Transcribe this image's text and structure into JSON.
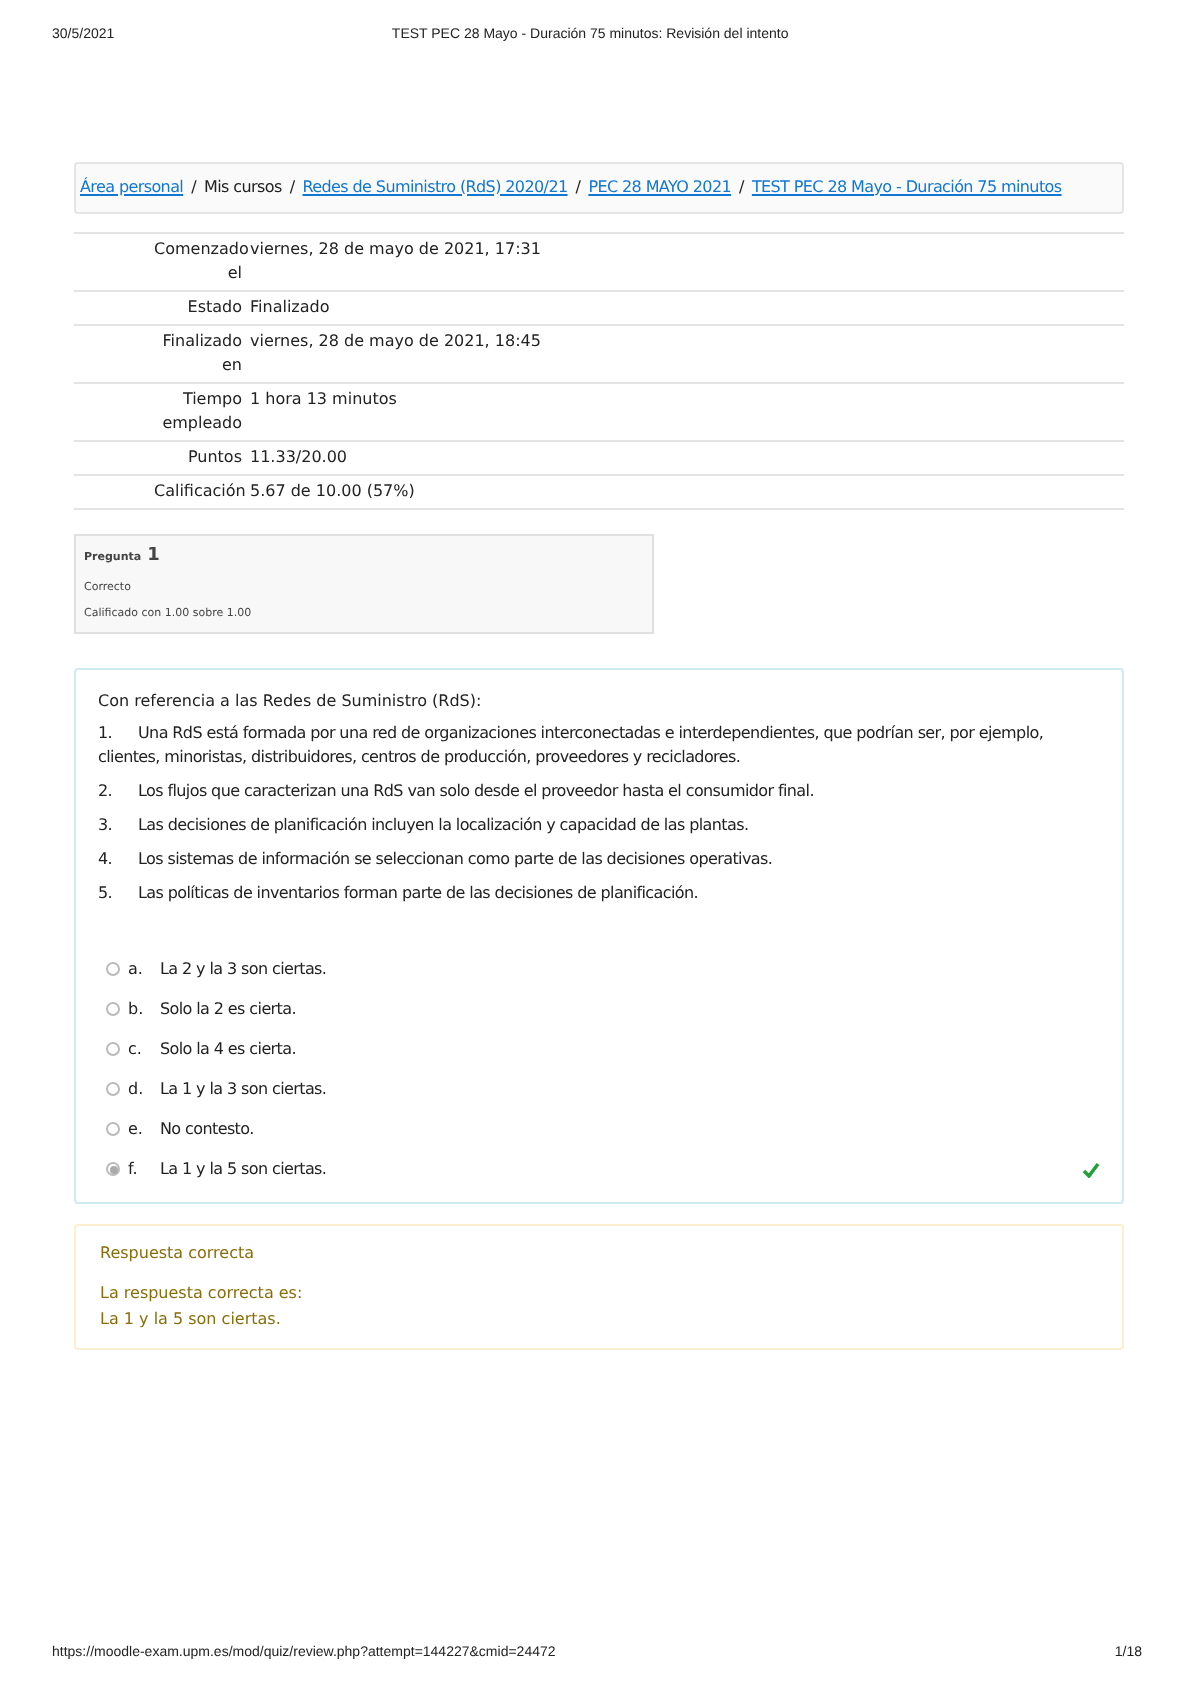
{
  "print_header": {
    "date": "30/5/2021",
    "title": "TEST PEC 28 Mayo - Duración 75 minutos: Revisión del intento"
  },
  "breadcrumb": [
    {
      "kind": "link",
      "label": "Área personal"
    },
    {
      "kind": "separator",
      "label": "/"
    },
    {
      "kind": "text",
      "label": "Mis cursos"
    },
    {
      "kind": "separator",
      "label": "/"
    },
    {
      "kind": "link",
      "label": "Redes de Suministro (RdS) 2020/21"
    },
    {
      "kind": "separator",
      "label": "/"
    },
    {
      "kind": "link",
      "label": "PEC 28 MAYO 2021"
    },
    {
      "kind": "separator",
      "label": "/"
    },
    {
      "kind": "link",
      "label": "TEST PEC 28 Mayo - Duración 75 minutos"
    }
  ],
  "summary": [
    {
      "label": "Comenzado el",
      "value": "viernes, 28 de mayo de 2021, 17:31"
    },
    {
      "label": "Estado",
      "value": "Finalizado"
    },
    {
      "label": "Finalizado en",
      "value": "viernes, 28 de mayo de 2021, 18:45"
    },
    {
      "label": "Tiempo empleado",
      "value": "1 hora 13 minutos"
    },
    {
      "label": "Puntos",
      "value": "11.33/20.00"
    },
    {
      "label": "Calificación",
      "value": "5.67 de 10.00 (57%)"
    }
  ],
  "question_info": {
    "label": "Pregunta",
    "number": "1",
    "state": "Correcto",
    "grade": "Calificado con 1.00 sobre 1.00"
  },
  "question": {
    "intro": "Con referencia a las Redes de Suministro (RdS):",
    "statements": [
      {
        "number": "1.",
        "text": "Una RdS está formada por una red de organizaciones interconectadas e interdependientes, que podrían ser, por ejemplo, clientes, minoristas, distribuidores, centros de producción, proveedores y recicladores."
      },
      {
        "number": "2.",
        "text": "Los flujos que caracterizan una RdS van solo desde el proveedor hasta el consumidor final."
      },
      {
        "number": "3.",
        "text": "Las decisiones de planificación incluyen la localización y capacidad de las plantas."
      },
      {
        "number": "4.",
        "text": "Los sistemas de información se seleccionan como parte de las decisiones operativas."
      },
      {
        "number": "5.",
        "text": "Las políticas de inventarios forman parte de las decisiones de planificación."
      }
    ],
    "options": [
      {
        "letter": "a.",
        "text": "La 2 y la 3 son ciertas.",
        "selected": false,
        "correct": false
      },
      {
        "letter": "b.",
        "text": "Solo la 2 es cierta.",
        "selected": false,
        "correct": false
      },
      {
        "letter": "c.",
        "text": "Solo la 4 es cierta.",
        "selected": false,
        "correct": false
      },
      {
        "letter": "d.",
        "text": "La 1 y la 3 son ciertas.",
        "selected": false,
        "correct": false
      },
      {
        "letter": "e.",
        "text": "No contesto.",
        "selected": false,
        "correct": false
      },
      {
        "letter": "f.",
        "text": "La 1 y la 5 son ciertas.",
        "selected": true,
        "correct": true
      }
    ]
  },
  "feedback": {
    "title": "Respuesta correcta",
    "lead": "La respuesta correcta es:",
    "answer": "La 1 y la 5 son ciertas."
  },
  "print_footer": {
    "url": "https://moodle-exam.upm.es/mod/quiz/review.php?attempt=144227&cmid=24472",
    "page": "1/18"
  }
}
